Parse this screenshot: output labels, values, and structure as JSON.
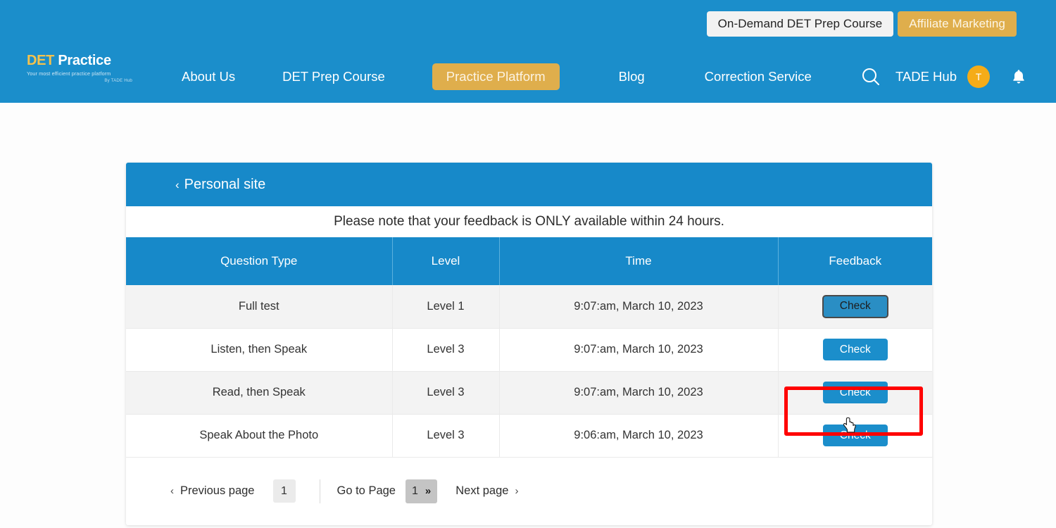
{
  "header": {
    "utility_buttons": [
      {
        "label": "On-Demand DET Prep Course",
        "style": "light"
      },
      {
        "label": "Affiliate Marketing",
        "style": "gold"
      }
    ],
    "brand": {
      "name_part1": "DET",
      "name_part2": "Practice",
      "tagline": "Your most efficient practice platform",
      "byline": "By TADE Hub"
    },
    "nav_items": [
      {
        "label": "About Us",
        "active": false
      },
      {
        "label": "DET Prep Course",
        "active": false
      },
      {
        "label": "Practice Platform",
        "active": true
      },
      {
        "label": "Blog",
        "active": false
      },
      {
        "label": "Correction Service",
        "active": false
      }
    ],
    "search_icon": "search-icon",
    "account_label": "TADE Hub",
    "avatar_initial": "T",
    "bell_icon": "bell-icon",
    "colors": {
      "bar_blue": "#1b8ecb",
      "accent_gold": "#dfae4c",
      "avatar_orange": "#f5ac18"
    }
  },
  "card": {
    "back_link": "Personal site",
    "back_chevron": "‹",
    "notice": "Please note that your feedback is ONLY available within 24 hours.",
    "table": {
      "columns": [
        "Question Type",
        "Level",
        "Time",
        "Feedback"
      ],
      "rows": [
        {
          "question_type": "Full test",
          "level": "Level 1",
          "time": "9:07:am, March 10, 2023",
          "action_label": "Check",
          "focused": true
        },
        {
          "question_type": "Listen, then Speak",
          "level": "Level 3",
          "time": "9:07:am, March 10, 2023",
          "action_label": "Check",
          "focused": false
        },
        {
          "question_type": "Read, then Speak",
          "level": "Level 3",
          "time": "9:07:am, March 10, 2023",
          "action_label": "Check",
          "focused": false
        },
        {
          "question_type": "Speak About the Photo",
          "level": "Level 3",
          "time": "9:06:am, March 10, 2023",
          "action_label": "Check",
          "focused": false
        }
      ]
    },
    "pagination": {
      "previous_label": "Previous page",
      "previous_chevron": "‹",
      "current_page_box": "1",
      "goto_label": "Go to Page",
      "goto_value": "1",
      "goto_chevron": "»",
      "next_label": "Next page",
      "next_chevron": "›"
    }
  },
  "annotation": {
    "highlight_color": "#ff0000",
    "highlight_target": "check-button-row-1"
  }
}
